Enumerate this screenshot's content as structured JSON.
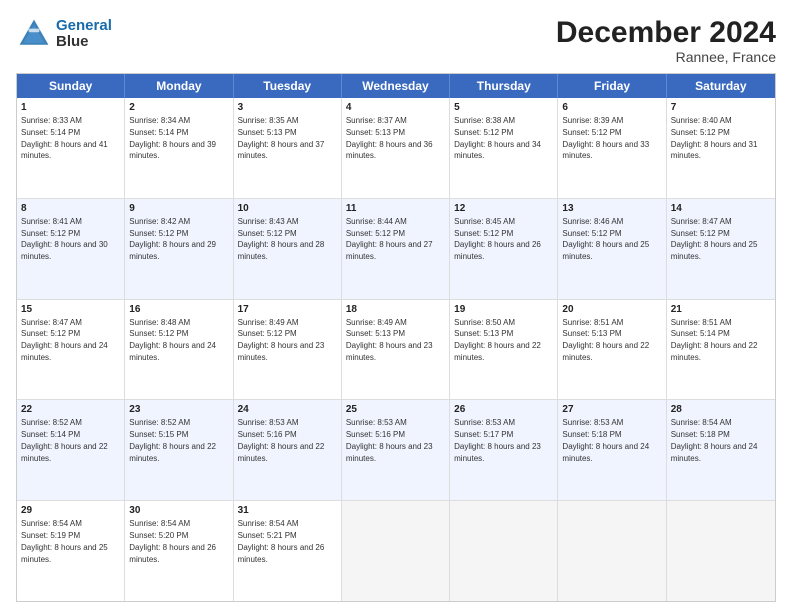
{
  "header": {
    "logo_line1": "General",
    "logo_line2": "Blue",
    "title": "December 2024",
    "subtitle": "Rannee, France"
  },
  "days": [
    "Sunday",
    "Monday",
    "Tuesday",
    "Wednesday",
    "Thursday",
    "Friday",
    "Saturday"
  ],
  "rows": [
    [
      {
        "day": "1",
        "sunrise": "Sunrise: 8:33 AM",
        "sunset": "Sunset: 5:14 PM",
        "daylight": "Daylight: 8 hours and 41 minutes."
      },
      {
        "day": "2",
        "sunrise": "Sunrise: 8:34 AM",
        "sunset": "Sunset: 5:14 PM",
        "daylight": "Daylight: 8 hours and 39 minutes."
      },
      {
        "day": "3",
        "sunrise": "Sunrise: 8:35 AM",
        "sunset": "Sunset: 5:13 PM",
        "daylight": "Daylight: 8 hours and 37 minutes."
      },
      {
        "day": "4",
        "sunrise": "Sunrise: 8:37 AM",
        "sunset": "Sunset: 5:13 PM",
        "daylight": "Daylight: 8 hours and 36 minutes."
      },
      {
        "day": "5",
        "sunrise": "Sunrise: 8:38 AM",
        "sunset": "Sunset: 5:12 PM",
        "daylight": "Daylight: 8 hours and 34 minutes."
      },
      {
        "day": "6",
        "sunrise": "Sunrise: 8:39 AM",
        "sunset": "Sunset: 5:12 PM",
        "daylight": "Daylight: 8 hours and 33 minutes."
      },
      {
        "day": "7",
        "sunrise": "Sunrise: 8:40 AM",
        "sunset": "Sunset: 5:12 PM",
        "daylight": "Daylight: 8 hours and 31 minutes."
      }
    ],
    [
      {
        "day": "8",
        "sunrise": "Sunrise: 8:41 AM",
        "sunset": "Sunset: 5:12 PM",
        "daylight": "Daylight: 8 hours and 30 minutes."
      },
      {
        "day": "9",
        "sunrise": "Sunrise: 8:42 AM",
        "sunset": "Sunset: 5:12 PM",
        "daylight": "Daylight: 8 hours and 29 minutes."
      },
      {
        "day": "10",
        "sunrise": "Sunrise: 8:43 AM",
        "sunset": "Sunset: 5:12 PM",
        "daylight": "Daylight: 8 hours and 28 minutes."
      },
      {
        "day": "11",
        "sunrise": "Sunrise: 8:44 AM",
        "sunset": "Sunset: 5:12 PM",
        "daylight": "Daylight: 8 hours and 27 minutes."
      },
      {
        "day": "12",
        "sunrise": "Sunrise: 8:45 AM",
        "sunset": "Sunset: 5:12 PM",
        "daylight": "Daylight: 8 hours and 26 minutes."
      },
      {
        "day": "13",
        "sunrise": "Sunrise: 8:46 AM",
        "sunset": "Sunset: 5:12 PM",
        "daylight": "Daylight: 8 hours and 25 minutes."
      },
      {
        "day": "14",
        "sunrise": "Sunrise: 8:47 AM",
        "sunset": "Sunset: 5:12 PM",
        "daylight": "Daylight: 8 hours and 25 minutes."
      }
    ],
    [
      {
        "day": "15",
        "sunrise": "Sunrise: 8:47 AM",
        "sunset": "Sunset: 5:12 PM",
        "daylight": "Daylight: 8 hours and 24 minutes."
      },
      {
        "day": "16",
        "sunrise": "Sunrise: 8:48 AM",
        "sunset": "Sunset: 5:12 PM",
        "daylight": "Daylight: 8 hours and 24 minutes."
      },
      {
        "day": "17",
        "sunrise": "Sunrise: 8:49 AM",
        "sunset": "Sunset: 5:12 PM",
        "daylight": "Daylight: 8 hours and 23 minutes."
      },
      {
        "day": "18",
        "sunrise": "Sunrise: 8:49 AM",
        "sunset": "Sunset: 5:13 PM",
        "daylight": "Daylight: 8 hours and 23 minutes."
      },
      {
        "day": "19",
        "sunrise": "Sunrise: 8:50 AM",
        "sunset": "Sunset: 5:13 PM",
        "daylight": "Daylight: 8 hours and 22 minutes."
      },
      {
        "day": "20",
        "sunrise": "Sunrise: 8:51 AM",
        "sunset": "Sunset: 5:13 PM",
        "daylight": "Daylight: 8 hours and 22 minutes."
      },
      {
        "day": "21",
        "sunrise": "Sunrise: 8:51 AM",
        "sunset": "Sunset: 5:14 PM",
        "daylight": "Daylight: 8 hours and 22 minutes."
      }
    ],
    [
      {
        "day": "22",
        "sunrise": "Sunrise: 8:52 AM",
        "sunset": "Sunset: 5:14 PM",
        "daylight": "Daylight: 8 hours and 22 minutes."
      },
      {
        "day": "23",
        "sunrise": "Sunrise: 8:52 AM",
        "sunset": "Sunset: 5:15 PM",
        "daylight": "Daylight: 8 hours and 22 minutes."
      },
      {
        "day": "24",
        "sunrise": "Sunrise: 8:53 AM",
        "sunset": "Sunset: 5:16 PM",
        "daylight": "Daylight: 8 hours and 22 minutes."
      },
      {
        "day": "25",
        "sunrise": "Sunrise: 8:53 AM",
        "sunset": "Sunset: 5:16 PM",
        "daylight": "Daylight: 8 hours and 23 minutes."
      },
      {
        "day": "26",
        "sunrise": "Sunrise: 8:53 AM",
        "sunset": "Sunset: 5:17 PM",
        "daylight": "Daylight: 8 hours and 23 minutes."
      },
      {
        "day": "27",
        "sunrise": "Sunrise: 8:53 AM",
        "sunset": "Sunset: 5:18 PM",
        "daylight": "Daylight: 8 hours and 24 minutes."
      },
      {
        "day": "28",
        "sunrise": "Sunrise: 8:54 AM",
        "sunset": "Sunset: 5:18 PM",
        "daylight": "Daylight: 8 hours and 24 minutes."
      }
    ],
    [
      {
        "day": "29",
        "sunrise": "Sunrise: 8:54 AM",
        "sunset": "Sunset: 5:19 PM",
        "daylight": "Daylight: 8 hours and 25 minutes."
      },
      {
        "day": "30",
        "sunrise": "Sunrise: 8:54 AM",
        "sunset": "Sunset: 5:20 PM",
        "daylight": "Daylight: 8 hours and 26 minutes."
      },
      {
        "day": "31",
        "sunrise": "Sunrise: 8:54 AM",
        "sunset": "Sunset: 5:21 PM",
        "daylight": "Daylight: 8 hours and 26 minutes."
      },
      null,
      null,
      null,
      null
    ]
  ]
}
